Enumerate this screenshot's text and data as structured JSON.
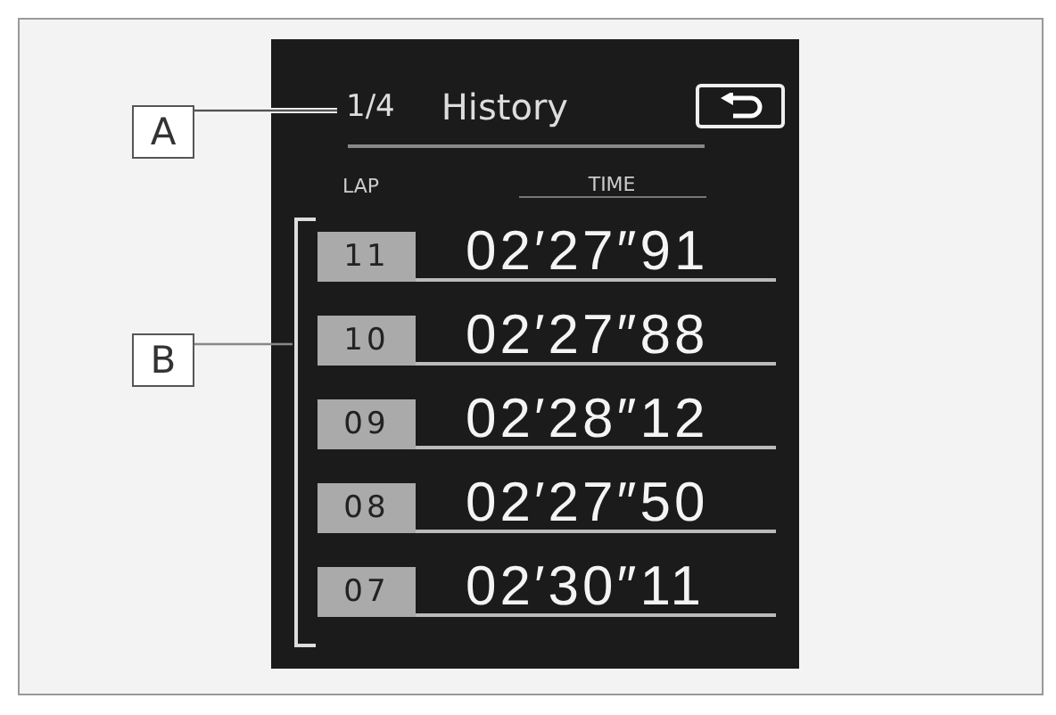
{
  "callouts": [
    {
      "label": "A"
    },
    {
      "label": "B"
    }
  ],
  "screen": {
    "page": "1/4",
    "title": "History",
    "columns": [
      "LAP",
      "TIME"
    ],
    "rows": [
      {
        "lap": "11",
        "time": "02′27″91"
      },
      {
        "lap": "10",
        "time": "02′27″88"
      },
      {
        "lap": "09",
        "time": "02′28″12"
      },
      {
        "lap": "08",
        "time": "02′27″50"
      },
      {
        "lap": "07",
        "time": "02′30″11"
      }
    ]
  }
}
